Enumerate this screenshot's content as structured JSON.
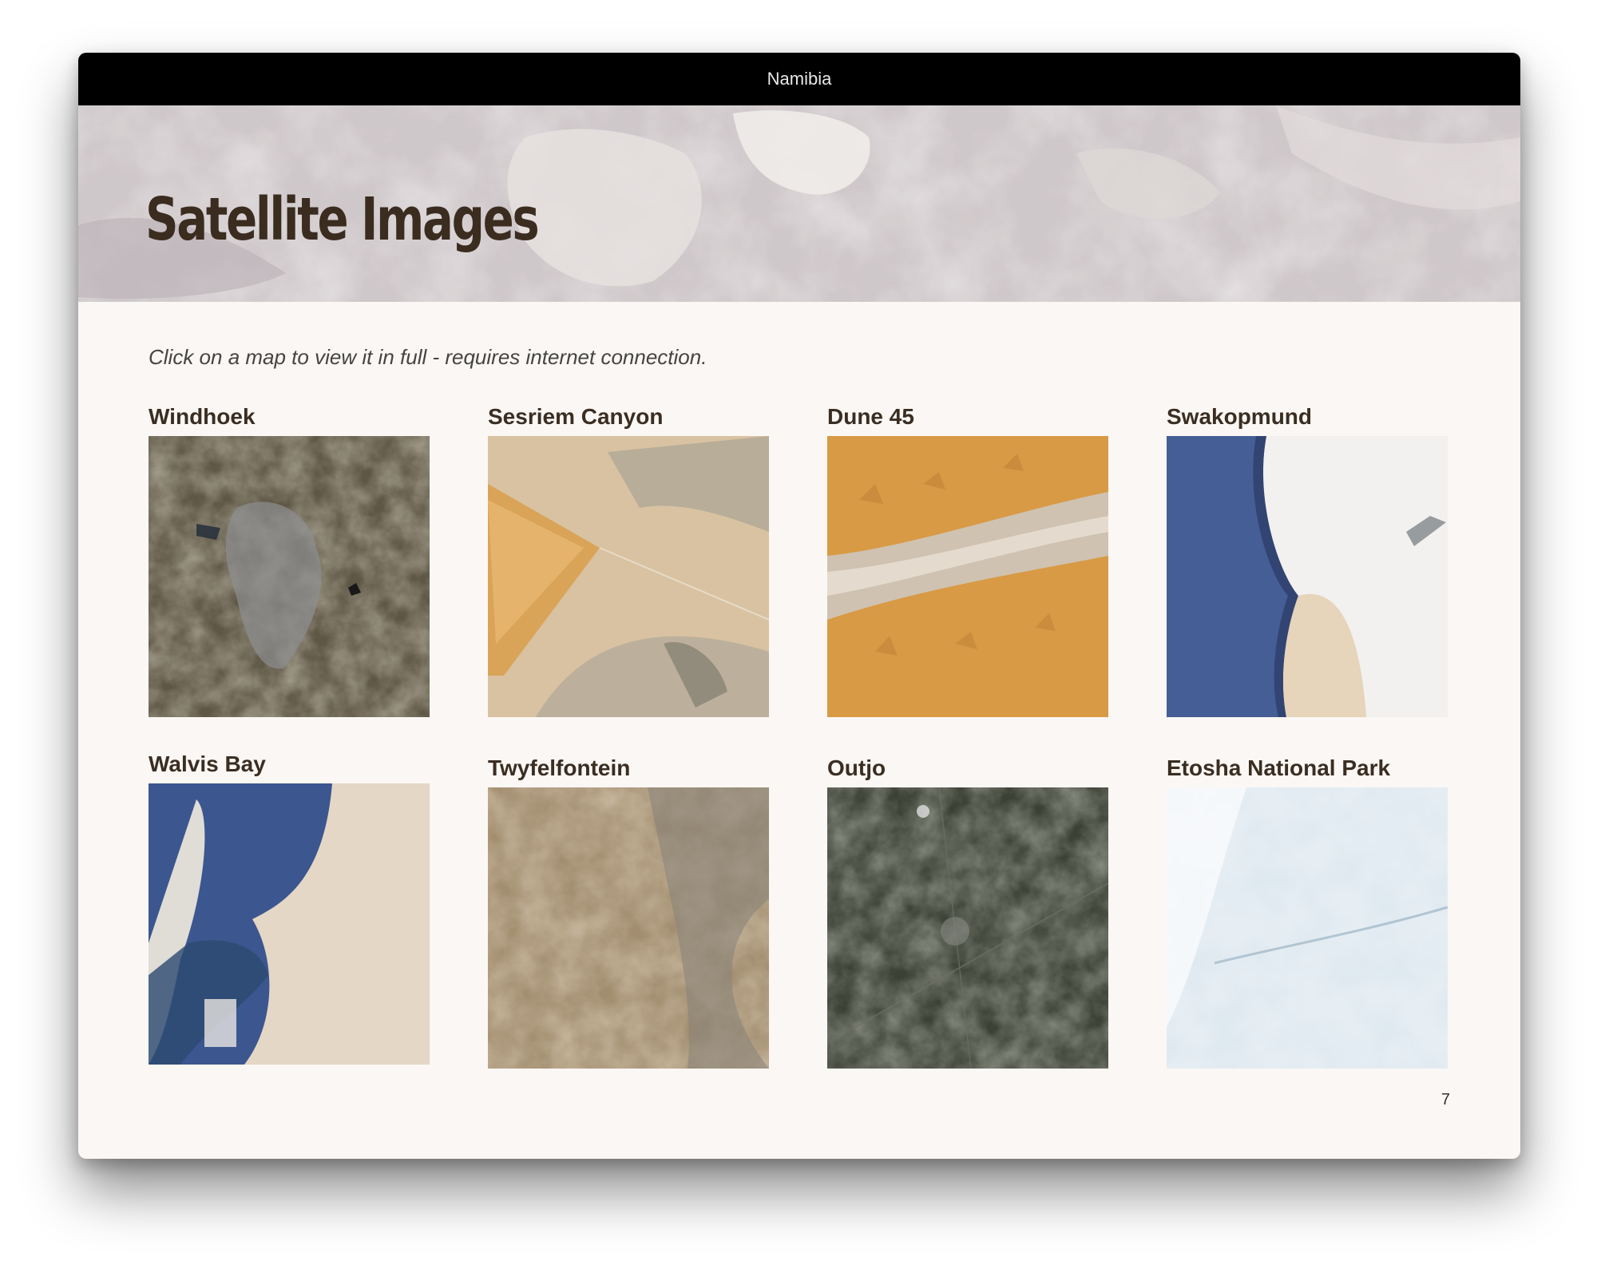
{
  "window": {
    "title": "Namibia"
  },
  "banner": {
    "title": "Satellite Images"
  },
  "instructions": "Click on a map to view it in full - requires internet connection.",
  "maps": [
    {
      "label": "Windhoek",
      "icon": "satellite-map-windhoek"
    },
    {
      "label": "Sesriem Canyon",
      "icon": "satellite-map-sesriem-canyon"
    },
    {
      "label": "Dune 45",
      "icon": "satellite-map-dune-45"
    },
    {
      "label": "Swakopmund",
      "icon": "satellite-map-swakopmund"
    },
    {
      "label": "Walvis Bay",
      "icon": "satellite-map-walvis-bay"
    },
    {
      "label": "Twyfelfontein",
      "icon": "satellite-map-twyfelfontein"
    },
    {
      "label": "Outjo",
      "icon": "satellite-map-outjo"
    },
    {
      "label": "Etosha National Park",
      "icon": "satellite-map-etosha"
    }
  ],
  "page_number": "7",
  "colors": {
    "titlebar": "#000000",
    "page_background": "#fbf7f4",
    "heading_text": "#3a2d22"
  }
}
